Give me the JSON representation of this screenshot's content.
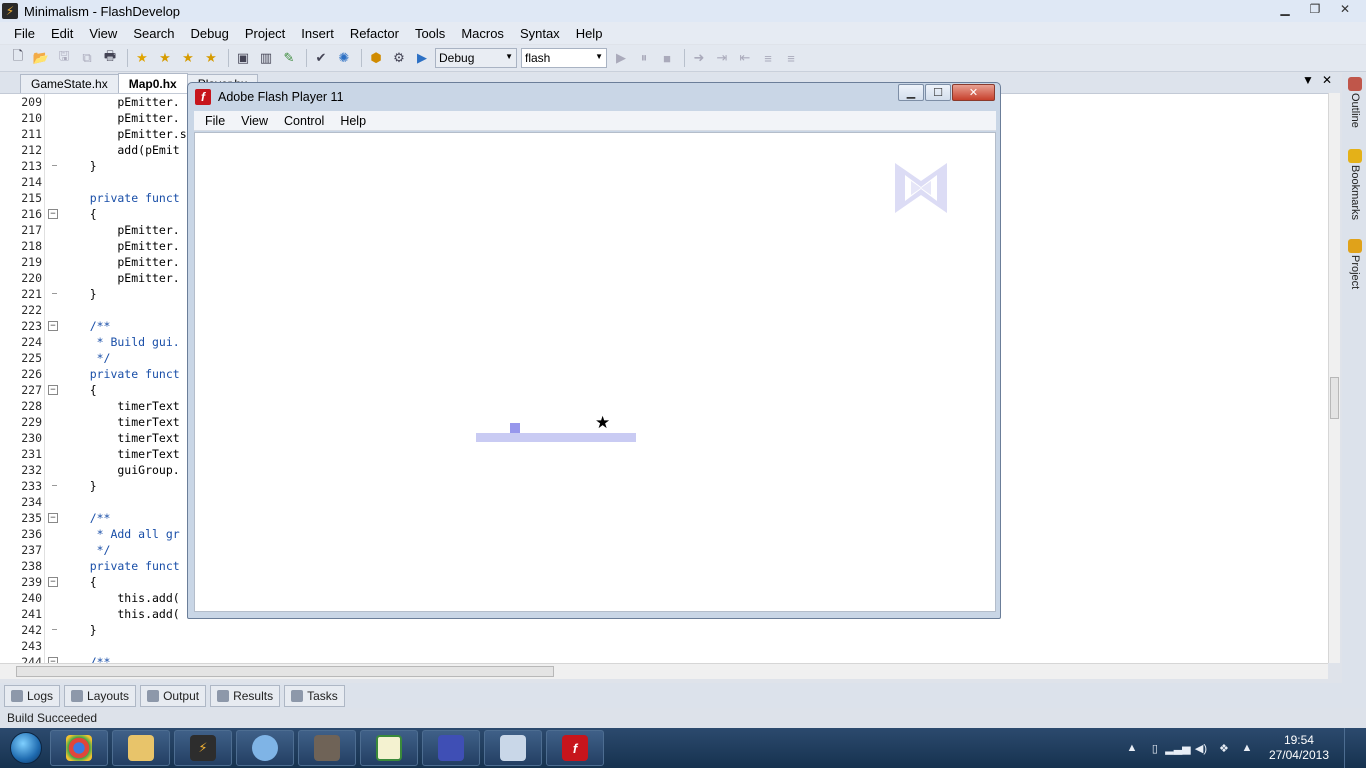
{
  "window": {
    "title": "Minimalism - FlashDevelop"
  },
  "menubar": [
    "File",
    "Edit",
    "View",
    "Search",
    "Debug",
    "Project",
    "Insert",
    "Refactor",
    "Tools",
    "Macros",
    "Syntax",
    "Help"
  ],
  "toolbar": {
    "config": "Debug",
    "platform": "flash"
  },
  "tabs": [
    {
      "label": "GameState.hx",
      "active": false
    },
    {
      "label": "Map0.hx",
      "active": true
    },
    {
      "label": "Player.hx",
      "active": false
    }
  ],
  "editor": {
    "lines": [
      {
        "n": "209",
        "text": "        pEmitter.",
        "type": "code"
      },
      {
        "n": "210",
        "text": "        pEmitter.",
        "type": "code"
      },
      {
        "n": "211",
        "text": "        pEmitter.s",
        "type": "code"
      },
      {
        "n": "212",
        "text": "        add(pEmit",
        "type": "code"
      },
      {
        "n": "213",
        "text": "    }",
        "type": "code"
      },
      {
        "n": "214",
        "text": "",
        "type": "code"
      },
      {
        "n": "215",
        "text": "    private funct",
        "type": "kw"
      },
      {
        "n": "216",
        "text": "    {",
        "type": "code",
        "fold": "minus"
      },
      {
        "n": "217",
        "text": "        pEmitter.",
        "type": "code"
      },
      {
        "n": "218",
        "text": "        pEmitter.",
        "type": "code"
      },
      {
        "n": "219",
        "text": "        pEmitter.",
        "type": "code"
      },
      {
        "n": "220",
        "text": "        pEmitter.",
        "type": "code"
      },
      {
        "n": "221",
        "text": "    }",
        "type": "code"
      },
      {
        "n": "222",
        "text": "",
        "type": "code"
      },
      {
        "n": "223",
        "text": "    /**",
        "type": "cm",
        "fold": "minus"
      },
      {
        "n": "224",
        "text": "     * Build gui.",
        "type": "cm"
      },
      {
        "n": "225",
        "text": "     */",
        "type": "cm"
      },
      {
        "n": "226",
        "text": "    private funct",
        "type": "kw"
      },
      {
        "n": "227",
        "text": "    {",
        "type": "code",
        "fold": "minus"
      },
      {
        "n": "228",
        "text": "        timerText",
        "type": "code"
      },
      {
        "n": "229",
        "text": "        timerText",
        "type": "code"
      },
      {
        "n": "230",
        "text": "        timerText",
        "type": "code"
      },
      {
        "n": "231",
        "text": "        timerText",
        "type": "code"
      },
      {
        "n": "232",
        "text": "        guiGroup.",
        "type": "code"
      },
      {
        "n": "233",
        "text": "    }",
        "type": "code"
      },
      {
        "n": "234",
        "text": "",
        "type": "code"
      },
      {
        "n": "235",
        "text": "    /**",
        "type": "cm",
        "fold": "minus"
      },
      {
        "n": "236",
        "text": "     * Add all gr",
        "type": "cm"
      },
      {
        "n": "237",
        "text": "     */",
        "type": "cm"
      },
      {
        "n": "238",
        "text": "    private funct",
        "type": "kw"
      },
      {
        "n": "239",
        "text": "    {",
        "type": "code",
        "fold": "minus"
      },
      {
        "n": "240",
        "text": "        this.add(",
        "type": "code"
      },
      {
        "n": "241",
        "text": "        this.add(",
        "type": "code"
      },
      {
        "n": "242",
        "text": "    }",
        "type": "code"
      },
      {
        "n": "243",
        "text": "",
        "type": "code"
      },
      {
        "n": "244",
        "text": "    /**",
        "type": "cm",
        "fold": "minus"
      }
    ]
  },
  "dock_right": [
    "Outline",
    "Bookmarks",
    "Project"
  ],
  "panels": [
    "Logs",
    "Layouts",
    "Output",
    "Results",
    "Tasks"
  ],
  "status": "Build Succeeded",
  "flash_player": {
    "title": "Adobe Flash Player 11",
    "menu": [
      "File",
      "View",
      "Control",
      "Help"
    ]
  },
  "clock": {
    "time": "19:54",
    "date": "27/04/2013"
  },
  "colors": {
    "keyword": "#1a4fa8",
    "platform": "#c9cbf3",
    "player": "#9797ec"
  }
}
